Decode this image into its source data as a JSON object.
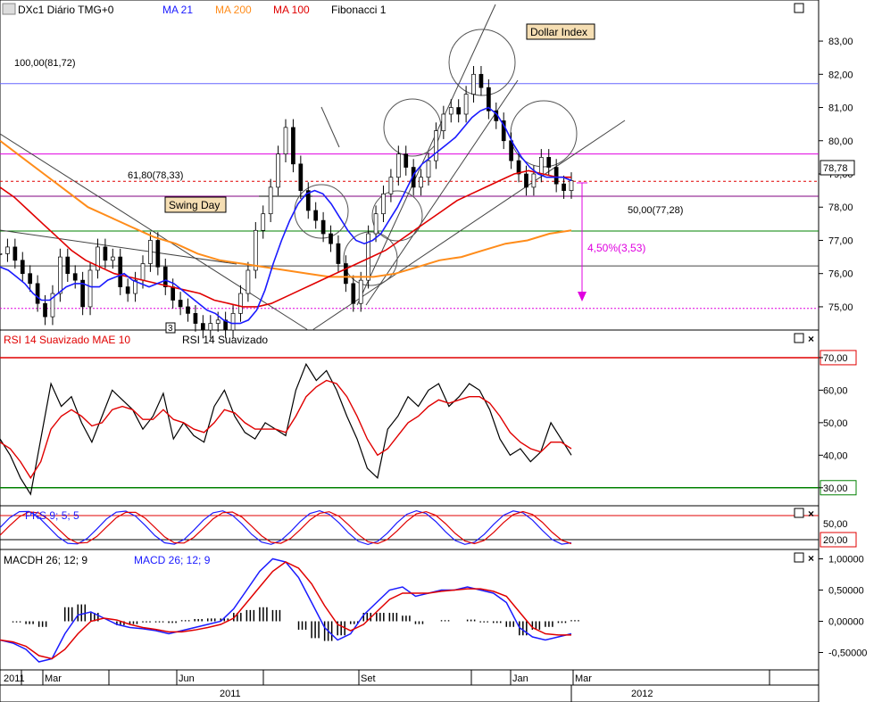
{
  "main": {
    "title_box_icon": "chart-window-icon",
    "legend": [
      {
        "label": "DXc1 Diário TMG+0",
        "color": "#000000"
      },
      {
        "label": "MA 21",
        "color": "#1a1aff"
      },
      {
        "label": "MA 200",
        "color": "#ff8c1a"
      },
      {
        "label": "MA 100",
        "color": "#e00000"
      },
      {
        "label": "Fibonacci 1",
        "color": "#000000"
      }
    ],
    "annotations": {
      "dollar_index": "Dollar Index",
      "swing_day": "Swing Day",
      "fib_100": "100,00(81,72)",
      "fib_618": "61,80(78,33)",
      "fib_50": "50,00(77,28)",
      "move_pct": "4,50%(3,53)",
      "bar_marker": "3"
    },
    "last_price": "78,78",
    "y_ticks": [
      "83,00",
      "82,00",
      "81,00",
      "80,00",
      "79,00",
      "78,00",
      "77,00",
      "76,00",
      "75,00"
    ]
  },
  "rsi": {
    "legend": [
      {
        "label": "RSI 14 Suavizado MAE 10",
        "color": "#e00000"
      },
      {
        "label": "RSI 14 Suavizado",
        "color": "#000000"
      }
    ],
    "y_ticks": [
      "70,00",
      "60,00",
      "50,00",
      "40,00",
      "30,00"
    ]
  },
  "pks": {
    "legend": [
      {
        "label": "PKS 9; 5; 5",
        "color": "#1a1aff"
      }
    ],
    "y_ticks": [
      "50,00",
      "20,00"
    ]
  },
  "macd": {
    "legend": [
      {
        "label": "MACDH 26; 12; 9",
        "color": "#000000"
      },
      {
        "label": "MACD 26; 12; 9",
        "color": "#1a1aff"
      }
    ],
    "y_ticks": [
      "1,00000",
      "0,50000",
      "0,00000",
      "-0,50000"
    ]
  },
  "x_axis": {
    "months": [
      "2011",
      "Mar",
      "Jun",
      "Set",
      "Jan",
      "Mar"
    ],
    "years": [
      "2011",
      "2012"
    ]
  },
  "chart_data": {
    "type": "line",
    "title": "DXc1 Diário TMG+0",
    "x": [
      "Jan 2011",
      "Mar 2011",
      "Jun 2011",
      "Set 2011",
      "Jan 2012",
      "Mar 2012"
    ],
    "ylim": [
      74.3,
      83.7
    ],
    "series": [
      {
        "name": "DXc1 Diário TMG+0",
        "values": [
          76.6,
          76.8,
          76.4,
          76.0,
          75.7,
          75.1,
          74.7,
          75.4,
          76.5,
          76.0,
          75.8,
          75.0,
          76.1,
          76.8,
          76.4,
          76.5,
          75.6,
          75.4,
          75.8,
          76.3,
          77.0,
          76.2,
          75.6,
          75.2,
          75.0,
          74.8,
          74.5,
          74.3,
          74.5,
          74.6,
          74.3,
          74.8,
          75.4,
          76.1,
          77.3,
          77.8,
          78.6,
          79.6,
          80.4,
          79.3,
          78.5,
          77.9,
          77.6,
          77.2,
          76.9,
          76.3,
          75.7,
          75.1,
          75.8,
          77.2,
          77.8,
          78.4,
          78.9,
          79.6,
          79.2,
          78.6,
          78.9,
          79.4,
          80.3,
          80.8,
          81.0,
          80.8,
          81.4,
          82.0,
          81.6,
          80.9,
          80.6,
          80.0,
          79.4,
          79.0,
          78.6,
          79.0,
          79.5,
          79.2,
          78.7,
          78.5,
          78.8
        ]
      },
      {
        "name": "MA 21",
        "values": [
          76.2,
          76.1,
          75.9,
          75.7,
          75.4,
          75.2,
          75.2,
          75.4,
          75.6,
          75.7,
          75.7,
          75.6,
          75.6,
          75.8,
          75.9,
          76.0,
          75.8,
          75.7,
          75.6,
          75.7,
          75.8,
          75.7,
          75.5,
          75.3,
          75.1,
          74.9,
          74.8,
          74.6,
          74.5,
          74.5,
          74.6,
          74.9,
          75.5,
          76.3,
          77.0,
          77.6,
          78.1,
          78.4,
          78.5,
          78.4,
          78.1,
          77.7,
          77.3,
          77.0,
          76.9,
          77.0,
          77.2,
          77.6,
          78.0,
          78.5,
          79.0,
          79.3,
          79.5,
          79.7,
          79.9,
          80.1,
          80.4,
          80.7,
          80.9,
          81.0,
          80.8,
          80.4,
          79.9,
          79.5,
          79.2,
          79.0,
          78.9,
          78.9,
          78.9,
          78.8
        ]
      },
      {
        "name": "MA 100",
        "values": [
          78.6,
          78.3,
          77.9,
          77.5,
          77.1,
          76.7,
          76.4,
          76.2,
          76.0,
          75.9,
          75.8,
          75.7,
          75.6,
          75.5,
          75.4,
          75.2,
          75.1,
          75.0,
          75.0,
          75.1,
          75.3,
          75.5,
          75.7,
          75.9,
          76.1,
          76.3,
          76.5,
          76.7,
          77.0,
          77.3,
          77.6,
          77.9,
          78.2,
          78.4,
          78.6,
          78.8,
          79.0,
          79.1,
          79.0,
          78.9,
          78.9
        ]
      },
      {
        "name": "MA 200",
        "values": [
          80.0,
          79.5,
          79.0,
          78.5,
          78.0,
          77.7,
          77.4,
          77.1,
          76.9,
          76.6,
          76.4,
          76.3,
          76.2,
          76.1,
          76.0,
          75.9,
          75.9,
          75.9,
          76.0,
          76.2,
          76.4,
          76.5,
          76.7,
          76.9,
          77.0,
          77.2,
          77.3
        ]
      }
    ],
    "panels": [
      {
        "name": "RSI 14 Suavizado",
        "levels": [
          70,
          30
        ],
        "ylim": [
          25,
          73
        ]
      },
      {
        "name": "PKS 9; 5; 5",
        "levels": [
          80,
          20
        ]
      },
      {
        "name": "MACD 26; 12; 9",
        "ylim": [
          -0.75,
          1.05
        ]
      }
    ]
  }
}
